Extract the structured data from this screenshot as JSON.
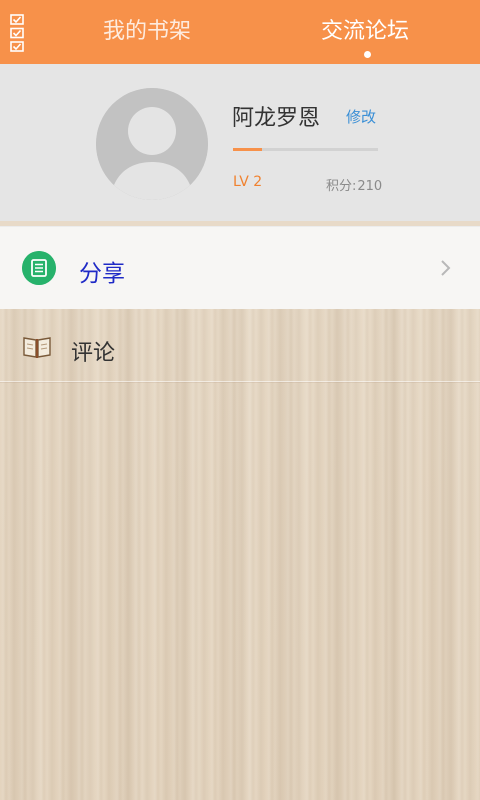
{
  "header": {
    "tabs": [
      {
        "label": "我的书架"
      },
      {
        "label": "交流论坛"
      }
    ],
    "active_tab": 1
  },
  "profile": {
    "username": "阿龙罗恩",
    "edit_label": "修改",
    "level": "LV 2",
    "points_label": "积分:",
    "points_value": "210",
    "progress": 0.2
  },
  "menu": {
    "share_label": "分享",
    "comment_label": "评论"
  },
  "colors": {
    "accent": "#f7914a",
    "share_icon": "#27b26b",
    "link": "#3a8fd6",
    "share_text": "#1f2ac6"
  }
}
